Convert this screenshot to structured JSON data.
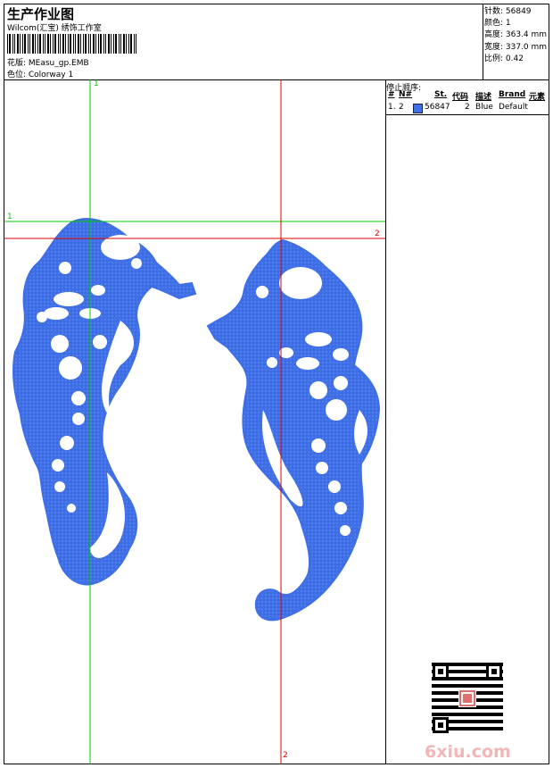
{
  "header": {
    "title": "生产作业图",
    "subtitle": "Wilcom(汇宝) 绣饰工作室",
    "design": "花版:  MEasu_gp.EMB",
    "colorway": "色位:  Colorway 1"
  },
  "stats": {
    "stitches": "针数: 56849",
    "colors": "颜色: 1",
    "height": "高度: 363.4 mm",
    "width": "宽度: 337.0 mm",
    "scale": "比例: 0.42"
  },
  "stop_sequence": {
    "title": "停止顺序:",
    "headers": [
      "#",
      "N#",
      "St.",
      "代码",
      "描述",
      "Brand",
      "元素"
    ],
    "rows": [
      {
        "idx": "1.",
        "needle": "2",
        "stitches": "56847",
        "code": "2",
        "desc": "Blue",
        "brand": "Default"
      }
    ]
  },
  "guides": {
    "green_v": "1",
    "green_h": "1",
    "red_h": "2",
    "red_v": "2"
  },
  "colors": {
    "thread": "#3f6fe6",
    "green_guide": "#00c800",
    "red_guide": "#e00000"
  },
  "watermark": "6xiu.com",
  "icons": [
    "qr-code-icon",
    "barcode-icon"
  ]
}
